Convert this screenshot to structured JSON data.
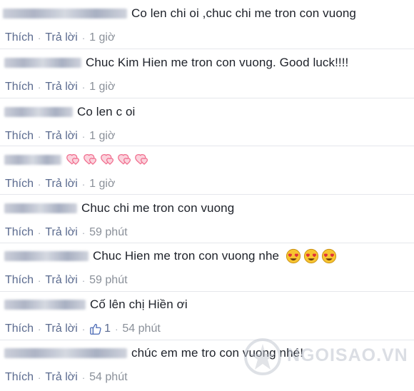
{
  "comments": [
    {
      "text": "Co len chi oi ,chuc chi me tron con vuong",
      "like": "Thích",
      "reply": "Trả lời",
      "time": "1 giờ"
    },
    {
      "text": "Chuc Kim Hien me tron con vuong. Good luck!!!!",
      "like": "Thích",
      "reply": "Trả lời",
      "time": "1 giờ"
    },
    {
      "text": "Co len c oi",
      "like": "Thích",
      "reply": "Trả lời",
      "time": "1 giờ"
    },
    {
      "text": "",
      "emoji": "pink-hearts-icon",
      "emoji_count": 5,
      "like": "Thích",
      "reply": "Trả lời",
      "time": "1 giờ"
    },
    {
      "text": "Chuc chi me tron con vuong",
      "like": "Thích",
      "reply": "Trả lời",
      "time": "59 phút"
    },
    {
      "text": "Chuc Hien me tron con vuong nhe",
      "emoji": "heart-eyes-face-icon",
      "emoji_count": 3,
      "like": "Thích",
      "reply": "Trả lời",
      "time": "59 phút"
    },
    {
      "text": "Cố lên chị Hiền ơi",
      "like": "Thích",
      "reply": "Trả lời",
      "likes_count": "1",
      "time": "54 phút"
    },
    {
      "text": "chúc em me tro con vuong nhé!",
      "like": "Thích",
      "reply": "Trả lời",
      "time": "54 phút"
    }
  ],
  "colors": {
    "link": "#5b6b8f",
    "text": "#1d2129",
    "meta": "#8a9099",
    "heart": "#f06b8c",
    "face": "#f7c531"
  },
  "watermark": {
    "text": "NGOISAO.VN"
  }
}
